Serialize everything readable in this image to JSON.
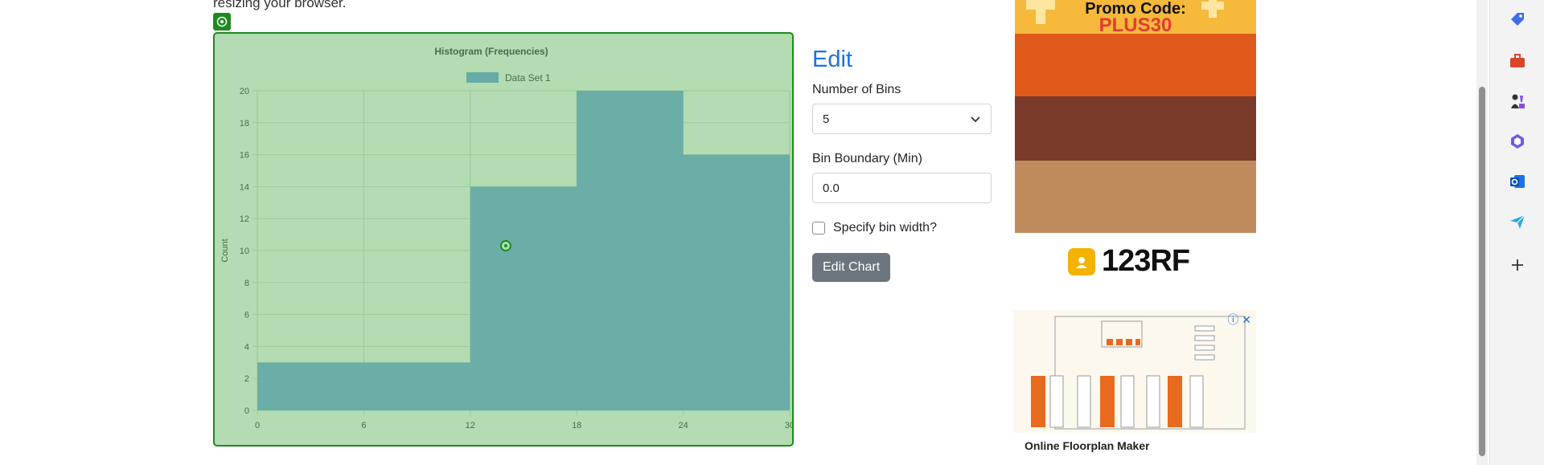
{
  "page": {
    "intro_text": "resizing your browser."
  },
  "chart_data": {
    "type": "bar",
    "title": "Histogram (Frequencies)",
    "xlabel": "",
    "ylabel": "Count",
    "legend_position": "top",
    "series": [
      {
        "name": "Data Set 1",
        "values": [
          3,
          3,
          14,
          20,
          16
        ]
      }
    ],
    "bin_edges": [
      0,
      6,
      12,
      18,
      24,
      30
    ],
    "x_ticks": [
      "0",
      "6",
      "12",
      "18",
      "24",
      "30"
    ],
    "y_ticks": [
      "0",
      "2",
      "4",
      "6",
      "8",
      "10",
      "12",
      "14",
      "16",
      "18",
      "20"
    ],
    "xlim": [
      0,
      30
    ],
    "ylim": [
      0,
      20
    ],
    "grid": true,
    "bar_color": "#66aba6",
    "background_color": "#b3dcb2",
    "cursor_marker": {
      "x": 14,
      "y": 10.3
    }
  },
  "edit_panel": {
    "title": "Edit",
    "bins_label": "Number of Bins",
    "bins_value": "5",
    "boundary_label": "Bin Boundary (Min)",
    "boundary_value": "0.0",
    "width_checkbox_label": "Specify bin width?",
    "submit_label": "Edit Chart"
  },
  "ads": {
    "promo_line1": "Promo Code:",
    "promo_code": "PLUS30",
    "brand": "123RF",
    "floorplan_caption": "Online Floorplan Maker"
  },
  "sidebar": {
    "icons": [
      "tag-icon",
      "briefcase-icon",
      "chess-icon",
      "copilot-icon",
      "outlook-icon",
      "send-icon",
      "plus-icon"
    ]
  }
}
